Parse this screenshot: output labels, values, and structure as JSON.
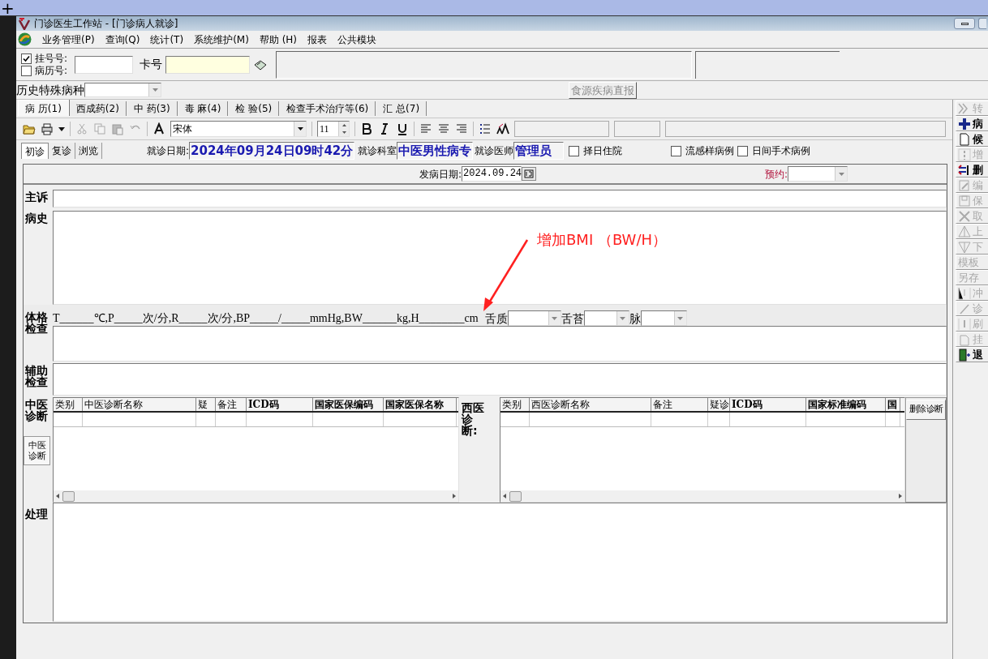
{
  "top_bar": {
    "glyph": "+"
  },
  "window": {
    "title": "门诊医生工作站 - [门诊病人就诊]"
  },
  "menu": [
    "业务管理(P)",
    "查询(Q)",
    "统计(T)",
    "系统维护(M)",
    "帮助 (H)",
    "报表",
    "公共模块"
  ],
  "patient_lookup": {
    "id_types": [
      {
        "label": "挂号号:",
        "checked": true
      },
      {
        "label": "病历号:",
        "checked": false
      }
    ],
    "card_label": "卡号"
  },
  "history": {
    "label": "历史特殊病种"
  },
  "report_button": "食源疾病直报",
  "tabs": [
    {
      "label": "病 历(1)",
      "selected": true
    },
    {
      "label": "西成药(2)",
      "selected": false
    },
    {
      "label": "中 药(3)",
      "selected": false
    },
    {
      "label": "毒 麻(4)",
      "selected": false
    },
    {
      "label": "检 验(5)",
      "selected": false
    },
    {
      "label": "检查手术治疗等(6)",
      "selected": false
    },
    {
      "label": "汇 总(7)",
      "selected": false
    }
  ],
  "toolbar": {
    "font": "宋体",
    "size": "11"
  },
  "visit_tabs": [
    {
      "label": "初诊",
      "selected": true
    },
    {
      "label": "复诊",
      "selected": false
    },
    {
      "label": "浏览",
      "selected": false
    }
  ],
  "visit": {
    "date_label": "就诊日期:",
    "date": "2024年09月24日09时42分",
    "dept_label": "就诊科室",
    "dept": "中医男性病专",
    "doctor_label": "就诊医师",
    "doctor": "管理员"
  },
  "visit_options": [
    {
      "label": "择日住院",
      "checked": false
    },
    {
      "label": "流感样病例",
      "checked": false
    },
    {
      "label": "日间手术病例",
      "checked": false
    }
  ],
  "onset": {
    "label": "发病日期:",
    "date": "2024.09.24"
  },
  "appointment": {
    "label": "预约:"
  },
  "fields": {
    "complaint": "主诉",
    "history": "病史",
    "exam": "体格检查",
    "auxiliary": "辅助检查",
    "treatment": "处理"
  },
  "vitals": "T______℃,P_____次/分,R_____次/分,BP_____/_____mmHg,BW______kg,H________cm",
  "tongue": [
    {
      "label": "舌质"
    },
    {
      "label": "舌苔"
    },
    {
      "label": "脉"
    }
  ],
  "tcm_diagnosis": {
    "label": "中医诊断",
    "side_tab": "中医诊断",
    "columns": [
      {
        "label": "类别",
        "bold": false
      },
      {
        "label": "中医诊断名称",
        "bold": false
      },
      {
        "label": "疑",
        "bold": false
      },
      {
        "label": "备注",
        "bold": false
      },
      {
        "label": "ICD码",
        "bold": true
      },
      {
        "label": "国家医保编码",
        "bold": true
      },
      {
        "label": "国家医保名称",
        "bold": true
      }
    ]
  },
  "western_diagnosis": {
    "label": "西医诊断:",
    "columns": [
      {
        "label": "类别",
        "bold": false
      },
      {
        "label": "西医诊断名称",
        "bold": false
      },
      {
        "label": "备注",
        "bold": false
      },
      {
        "label": "疑诊",
        "bold": false
      },
      {
        "label": "ICD码",
        "bold": true
      },
      {
        "label": "国家标准编码",
        "bold": true
      },
      {
        "label": "国",
        "bold": true
      }
    ],
    "delete_button": "删除诊断"
  },
  "annotation": {
    "text": "增加BMI （BW/H）"
  },
  "side_toolbar": [
    {
      "label": "转",
      "disabled": true
    },
    {
      "label": "病",
      "disabled": false
    },
    {
      "label": "候",
      "disabled": false
    },
    {
      "label": "增",
      "disabled": true
    },
    {
      "label": "删",
      "disabled": false
    },
    {
      "label": "编",
      "disabled": true
    },
    {
      "label": "保",
      "disabled": true
    },
    {
      "label": "取",
      "disabled": true
    },
    {
      "label": "上",
      "disabled": true
    },
    {
      "label": "下",
      "disabled": true
    },
    {
      "label": "模板",
      "disabled": true
    },
    {
      "label": "另存",
      "disabled": true
    },
    {
      "label": "冲",
      "disabled": true
    },
    {
      "label": "诊",
      "disabled": true
    },
    {
      "label": "刷",
      "disabled": true
    },
    {
      "label": "挂",
      "disabled": true
    },
    {
      "label": "退",
      "disabled": false
    }
  ]
}
